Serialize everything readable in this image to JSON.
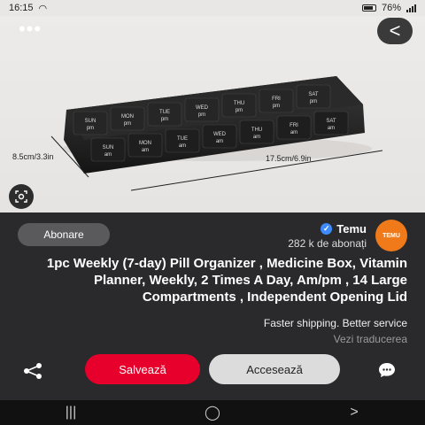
{
  "status_bar": {
    "left_text": "16:15",
    "right_text": "76%"
  },
  "hero": {
    "dim_width": "17.5cm/6.9in",
    "dim_depth": "8.5cm/3.3in",
    "days": [
      "SAT",
      "FRI",
      "THU",
      "WED",
      "TUE",
      "MON",
      "SUN"
    ],
    "am": "am",
    "pm": "pm",
    "back_glyph": "<",
    "more_glyph": "•••"
  },
  "seller": {
    "name": "Temu",
    "followers": "282 k de abonați",
    "avatar_text": "TEMU",
    "follow_label": "Abonare"
  },
  "product": {
    "title": "1pc Weekly (7-day) Pill Organizer , Medicine Box, Vitamin Planner, Weekly, 2 Times A Day, Am/pm , 14 Large Compartments , Independent Opening Lid",
    "tagline": "Faster shipping. Better service",
    "translate": "Vezi traducerea"
  },
  "actions": {
    "save_label": "Salvează",
    "access_label": "Accesează"
  },
  "icons": {
    "share": "share-icon",
    "comment": "comment-icon",
    "lens": "visual-search-icon",
    "back": "back-icon",
    "more": "more-icon"
  },
  "colors": {
    "save": "#e6002b",
    "access": "#dcdcdc",
    "avatar": "#f07a1a",
    "background": "#2a2a2c"
  }
}
